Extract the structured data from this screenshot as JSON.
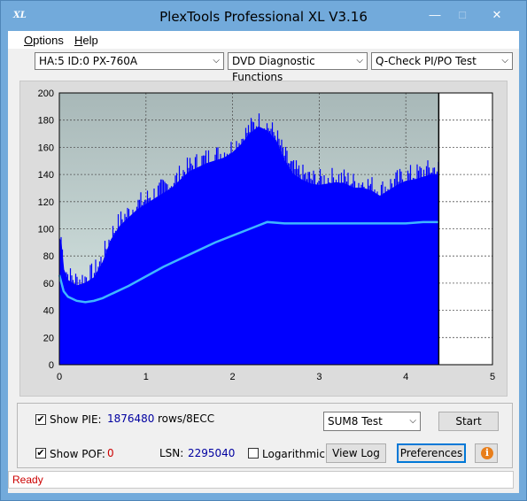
{
  "window": {
    "title": "PlexTools Professional XL V3.16",
    "icon_text": "XL"
  },
  "menu": [
    {
      "label": "Options",
      "hotkey": "O"
    },
    {
      "label": "Help",
      "hotkey": "H"
    }
  ],
  "toolbar": {
    "device": "HA:5 ID:0  PX-760A",
    "function": "DVD Diagnostic Functions",
    "test": "Q-Check PI/PO Test"
  },
  "chart_data": {
    "type": "area",
    "x_ticks": [
      "0",
      "1",
      "2",
      "3",
      "4",
      "5"
    ],
    "y_ticks": [
      "0",
      "20",
      "40",
      "60",
      "80",
      "100",
      "120",
      "140",
      "160",
      "180",
      "200"
    ],
    "xlim": [
      0,
      5
    ],
    "ylim": [
      0,
      200
    ],
    "grid": true,
    "data_end_x": 4.38,
    "colors": {
      "fill": "#0000ff",
      "line": "#3fb6ff",
      "bg_top": "#a8b8b8",
      "bg_bottom": "#dcebe8"
    },
    "series": [
      {
        "type": "area",
        "x": [
          0,
          0.02,
          0.05,
          0.1,
          0.2,
          0.3,
          0.4,
          0.5,
          0.6,
          0.7,
          0.8,
          0.9,
          1.0,
          1.1,
          1.2,
          1.3,
          1.4,
          1.5,
          1.6,
          1.7,
          1.8,
          1.9,
          2.0,
          2.1,
          2.2,
          2.3,
          2.4,
          2.5,
          2.6,
          2.7,
          2.8,
          2.9,
          3.0,
          3.1,
          3.2,
          3.3,
          3.4,
          3.5,
          3.6,
          3.7,
          3.8,
          3.9,
          4.0,
          4.1,
          4.2,
          4.3,
          4.38
        ],
        "values": [
          93,
          90,
          70,
          62,
          58,
          60,
          64,
          75,
          92,
          102,
          108,
          114,
          118,
          122,
          126,
          130,
          136,
          142,
          145,
          148,
          150,
          152,
          156,
          162,
          170,
          175,
          172,
          165,
          150,
          140,
          136,
          133,
          132,
          133,
          134,
          133,
          130,
          130,
          128,
          124,
          128,
          132,
          135,
          136,
          138,
          140,
          140
        ]
      },
      {
        "type": "line",
        "x": [
          0,
          0.05,
          0.1,
          0.2,
          0.3,
          0.4,
          0.5,
          0.6,
          0.8,
          1.0,
          1.2,
          1.4,
          1.6,
          1.8,
          2.0,
          2.2,
          2.4,
          2.6,
          2.8,
          3.0,
          3.2,
          3.4,
          3.6,
          3.8,
          4.0,
          4.2,
          4.38
        ],
        "values": [
          66,
          54,
          50,
          47,
          46,
          47,
          49,
          52,
          58,
          65,
          72,
          78,
          84,
          90,
          95,
          100,
          105,
          104,
          104,
          104,
          104,
          104,
          104,
          104,
          104,
          105,
          105
        ]
      }
    ]
  },
  "pie": {
    "show_label": "Show PIE:",
    "checked": true,
    "value": "1876480",
    "unit": "rows/8ECC"
  },
  "poe": {
    "show_label": "Show POF:",
    "checked": true,
    "value": "0"
  },
  "lsn": {
    "label": "LSN:",
    "value": "2295040"
  },
  "logarithmic": {
    "label": "Logarithmic",
    "checked": false
  },
  "sum_select": "SUM8 Test",
  "buttons": {
    "start": "Start",
    "view_log": "View Log",
    "preferences": "Preferences"
  },
  "status": "Ready"
}
